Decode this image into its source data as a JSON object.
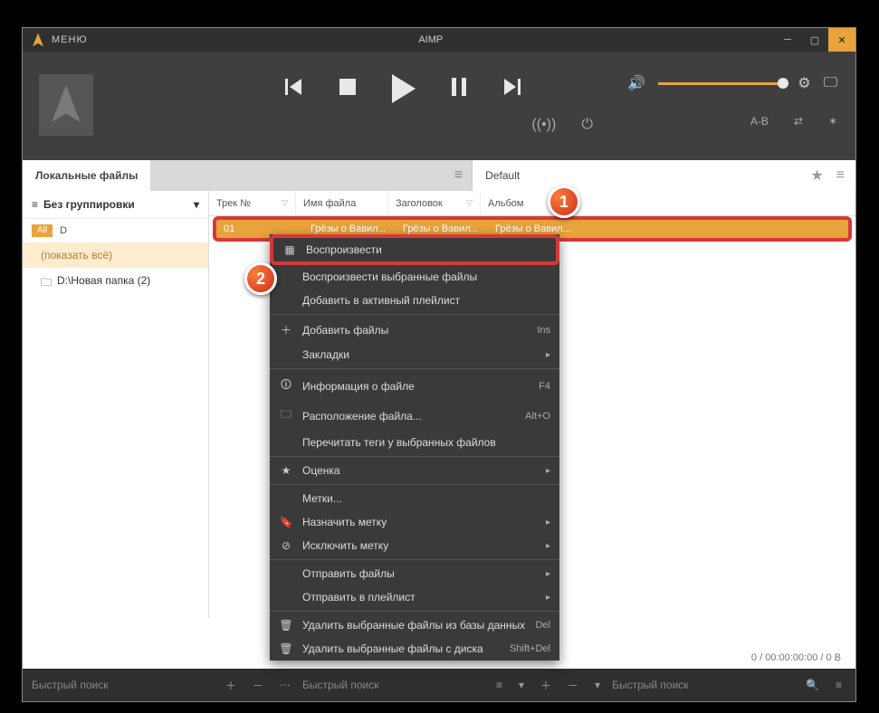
{
  "titlebar": {
    "menu": "МЕНЮ",
    "app": "AIMP"
  },
  "tabs": {
    "left": "Локальные файлы",
    "right": "Default"
  },
  "sidebar": {
    "group": "Без группировки",
    "chip_all": "All",
    "chip_d": "D",
    "show_all": "(показать всё)",
    "folder": "D:\\Новая папка (2)"
  },
  "cols": {
    "track": "Трек №",
    "file": "Имя файла",
    "title": "Заголовок",
    "album": "Альбом"
  },
  "row": {
    "num": "01",
    "file": "Грёзы о Вавил...",
    "title": "Грёзы о Вавил...",
    "album": "Грёзы о Вавил..."
  },
  "ctx": {
    "play": "Воспроизвести",
    "play_sel": "Воспроизвести выбранные файлы",
    "add_active": "Добавить в активный плейлист",
    "add_files": "Добавить файлы",
    "add_files_sc": "Ins",
    "bookmarks": "Закладки",
    "info": "Информация о файле",
    "info_sc": "F4",
    "location": "Расположение файла...",
    "location_sc": "Alt+O",
    "reread": "Перечитать теги у выбранных файлов",
    "rating": "Оценка",
    "labels": "Метки...",
    "assign_label": "Назначить метку",
    "exclude_label": "Исключить метку",
    "send_files": "Отправить файлы",
    "send_playlist": "Отправить в плейлист",
    "del_db": "Удалить выбранные файлы из базы данных",
    "del_db_sc": "Del",
    "del_disk": "Удалить выбранные файлы с диска",
    "del_disk_sc": "Shift+Del"
  },
  "status": "0 / 00:00:00:00 / 0 B",
  "footer": {
    "search": "Быстрый поиск"
  },
  "badge": {
    "one": "1",
    "two": "2"
  }
}
